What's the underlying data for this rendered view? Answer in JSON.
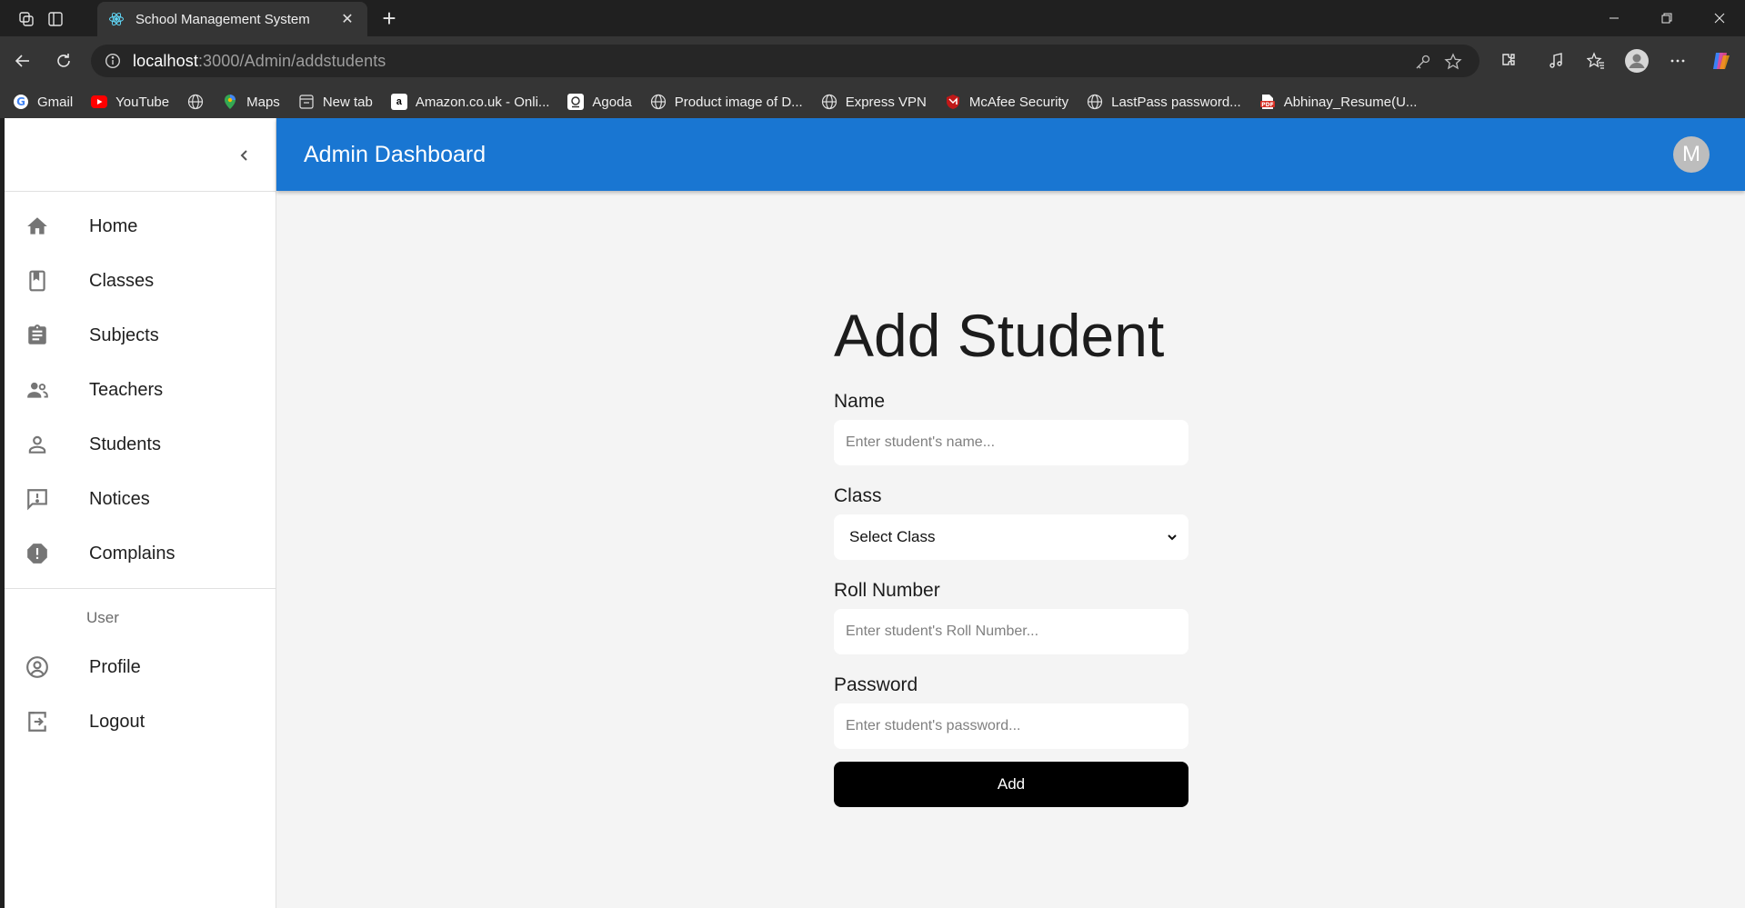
{
  "browser": {
    "tab_title": "School Management System",
    "url_host": "localhost",
    "url_path": ":3000/Admin/addstudents",
    "bookmarks": [
      {
        "label": "Gmail",
        "icon": "gmail-icon",
        "color": "#ea4335"
      },
      {
        "label": "YouTube",
        "icon": "youtube-icon",
        "color": "#ff0000"
      },
      {
        "label": "",
        "icon": "globe-icon",
        "color": "#e0e0e0"
      },
      {
        "label": "Maps",
        "icon": "maps-icon",
        "color": "#34a853"
      },
      {
        "label": "New tab",
        "icon": "newtab-icon",
        "color": "#e0e0e0"
      },
      {
        "label": "Amazon.co.uk - Onli...",
        "icon": "amazon-icon",
        "color": "#ffffff"
      },
      {
        "label": "Agoda",
        "icon": "agoda-icon",
        "color": "#ffffff"
      },
      {
        "label": "Product image of D...",
        "icon": "globe-icon",
        "color": "#e0e0e0"
      },
      {
        "label": "Express VPN",
        "icon": "globe-icon",
        "color": "#e0e0e0"
      },
      {
        "label": "McAfee Security",
        "icon": "mcafee-icon",
        "color": "#c01818"
      },
      {
        "label": "LastPass password...",
        "icon": "globe-icon",
        "color": "#e0e0e0"
      },
      {
        "label": "Abhinay_Resume(U...",
        "icon": "pdf-icon",
        "color": "#d93025"
      }
    ]
  },
  "appbar": {
    "title": "Admin Dashboard",
    "avatar_letter": "M",
    "color": "#1976d2"
  },
  "sidebar": {
    "items": [
      {
        "label": "Home",
        "icon": "home-icon"
      },
      {
        "label": "Classes",
        "icon": "classes-icon"
      },
      {
        "label": "Subjects",
        "icon": "subjects-icon"
      },
      {
        "label": "Teachers",
        "icon": "teachers-icon"
      },
      {
        "label": "Students",
        "icon": "students-icon"
      },
      {
        "label": "Notices",
        "icon": "notices-icon"
      },
      {
        "label": "Complains",
        "icon": "complains-icon"
      }
    ],
    "user_header": "User",
    "user_items": [
      {
        "label": "Profile",
        "icon": "profile-icon"
      },
      {
        "label": "Logout",
        "icon": "logout-icon"
      }
    ]
  },
  "form": {
    "title": "Add Student",
    "name_label": "Name",
    "name_placeholder": "Enter student's name...",
    "class_label": "Class",
    "class_selected": "Select Class",
    "roll_label": "Roll Number",
    "roll_placeholder": "Enter student's Roll Number...",
    "password_label": "Password",
    "password_placeholder": "Enter student's password...",
    "submit_label": "Add"
  }
}
